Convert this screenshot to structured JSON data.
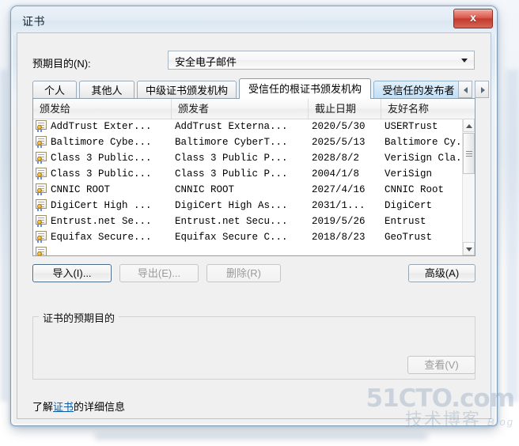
{
  "window": {
    "title": "证书",
    "close_label": "x"
  },
  "purpose": {
    "label": "预期目的(N):",
    "value": "安全电子邮件"
  },
  "tabs": [
    {
      "label": "个人",
      "state": "normal"
    },
    {
      "label": "其他人",
      "state": "normal"
    },
    {
      "label": "中级证书颁发机构",
      "state": "normal"
    },
    {
      "label": "受信任的根证书颁发机构",
      "state": "selected"
    },
    {
      "label": "受信任的发布者",
      "state": "highlight"
    }
  ],
  "tab_nav": {
    "left_icon": "left-arrow-icon",
    "right_icon": "right-arrow-icon"
  },
  "table": {
    "columns": [
      "颁发给",
      "颁发者",
      "截止日期",
      "友好名称"
    ],
    "rows": [
      [
        "AddTrust Exter...",
        "AddTrust Externa...",
        "2020/5/30",
        "USERTrust"
      ],
      [
        "Baltimore Cybe...",
        "Baltimore CyberT...",
        "2025/5/13",
        "Baltimore Cy..."
      ],
      [
        "Class 3 Public...",
        "Class 3 Public P...",
        "2028/8/2",
        "VeriSign Cla..."
      ],
      [
        "Class 3 Public...",
        "Class 3 Public P...",
        "2004/1/8",
        "VeriSign"
      ],
      [
        "CNNIC ROOT",
        "CNNIC ROOT",
        "2027/4/16",
        "CNNIC Root"
      ],
      [
        "DigiCert High ...",
        "DigiCert High As...",
        "2031/1...",
        "DigiCert"
      ],
      [
        "Entrust.net Se...",
        "Entrust.net Secu...",
        "2019/5/26",
        "Entrust"
      ],
      [
        "Equifax Secure...",
        "Equifax Secure C...",
        "2018/8/23",
        "GeoTrust"
      ]
    ]
  },
  "buttons": {
    "import": "导入(I)...",
    "export": "导出(E)...",
    "remove": "删除(R)",
    "advanced": "高级(A)",
    "view": "查看(V)"
  },
  "group": {
    "title": "证书的预期目的"
  },
  "footer": {
    "prefix": "了解",
    "link": "证书",
    "suffix": "的详细信息"
  },
  "watermark": {
    "top": "51CTO.com",
    "bottom": "技术博客",
    "blog": "Blog"
  },
  "colors": {
    "close_red": "#c23b2e",
    "tab_highlight": "#cfe6f8",
    "link_blue": "#0a5ca8",
    "dialog_bg": "#f0f0f0"
  }
}
